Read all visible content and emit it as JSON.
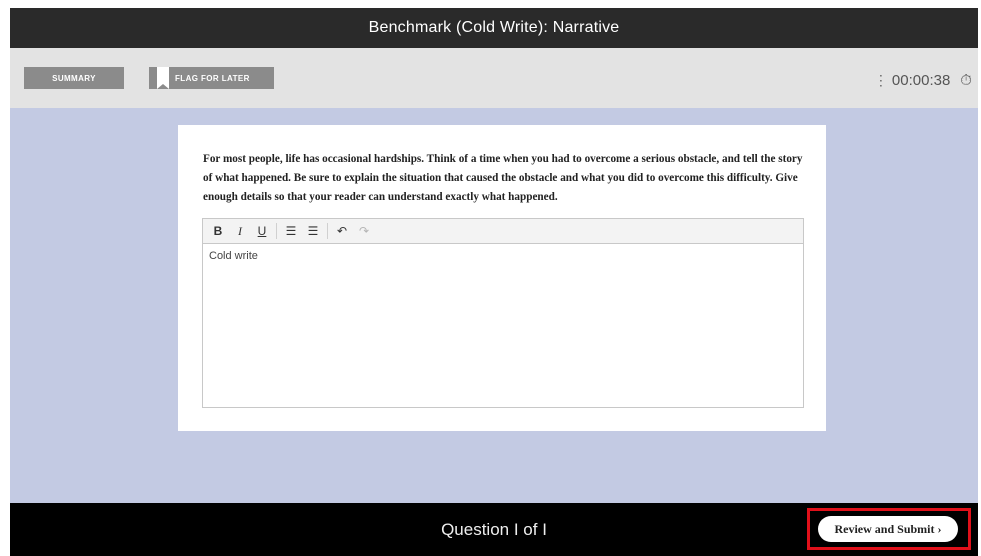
{
  "header": {
    "title": "Benchmark (Cold Write): Narrative"
  },
  "toolbar": {
    "summary_label": "SUMMARY",
    "flag_label": "FLAG FOR LATER",
    "timer_dots": "⋮",
    "timer": "00:00:38",
    "stopwatch_glyph": "⏱"
  },
  "prompt": {
    "text": "For most people, life has occasional hardships. Think of a time when you had to overcome a serious obstacle, and tell the story of what happened. Be sure to explain the situation that caused the obstacle and what you did to overcome this difficulty. Give enough details so that your reader can understand exactly what happened."
  },
  "editor": {
    "tools": [
      {
        "name": "bold",
        "glyph": "B"
      },
      {
        "name": "italic",
        "glyph": "I"
      },
      {
        "name": "underline",
        "glyph": "U"
      },
      {
        "name": "bulleted-list",
        "glyph": "☰"
      },
      {
        "name": "numbered-list",
        "glyph": "☰"
      },
      {
        "name": "undo",
        "glyph": "↶"
      },
      {
        "name": "redo",
        "glyph": "↷"
      }
    ],
    "content": "Cold write"
  },
  "footer": {
    "question_label": "Question  I  of  I",
    "review_label": "Review and Submit ›"
  },
  "colors": {
    "content_bg": "#c3cae3",
    "highlight": "#e0101a"
  }
}
